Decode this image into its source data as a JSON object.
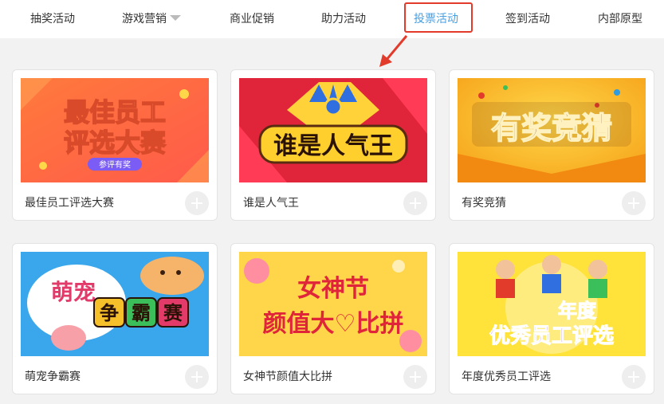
{
  "nav": {
    "tabs": [
      {
        "label": "抽奖活动"
      },
      {
        "label": "游戏营销"
      },
      {
        "label": "商业促销"
      },
      {
        "label": "助力活动"
      },
      {
        "label": "投票活动"
      },
      {
        "label": "签到活动"
      },
      {
        "label": "内部原型"
      }
    ],
    "active_index": 4,
    "caret_icon": "caret-down-icon"
  },
  "colors": {
    "active_tab": "#4a9fe0",
    "highlight_box": "#e23b2b",
    "page_bg": "#f2f2f2"
  },
  "cards": [
    {
      "title": "最佳员工评选大赛",
      "banner_line1": "最佳员工",
      "banner_line2": "评选大赛",
      "banner_badge": "参评有奖",
      "add_icon": "plus-icon"
    },
    {
      "title": "谁是人气王",
      "banner_line1": "谁是人气王",
      "add_icon": "plus-icon"
    },
    {
      "title": "有奖竞猜",
      "banner_line1": "有奖竞猜",
      "add_icon": "plus-icon"
    },
    {
      "title": "萌宠争霸赛",
      "banner_line1": "萌宠",
      "banner_tiles": [
        "争",
        "霸",
        "赛"
      ],
      "add_icon": "plus-icon"
    },
    {
      "title": "女神节颜值大比拼",
      "banner_line1": "女神节",
      "banner_line2": "颜值大♡比拼",
      "add_icon": "plus-icon"
    },
    {
      "title": "年度优秀员工评选",
      "banner_line1": "年度",
      "banner_line2": "优秀员工评选",
      "add_icon": "plus-icon"
    }
  ]
}
